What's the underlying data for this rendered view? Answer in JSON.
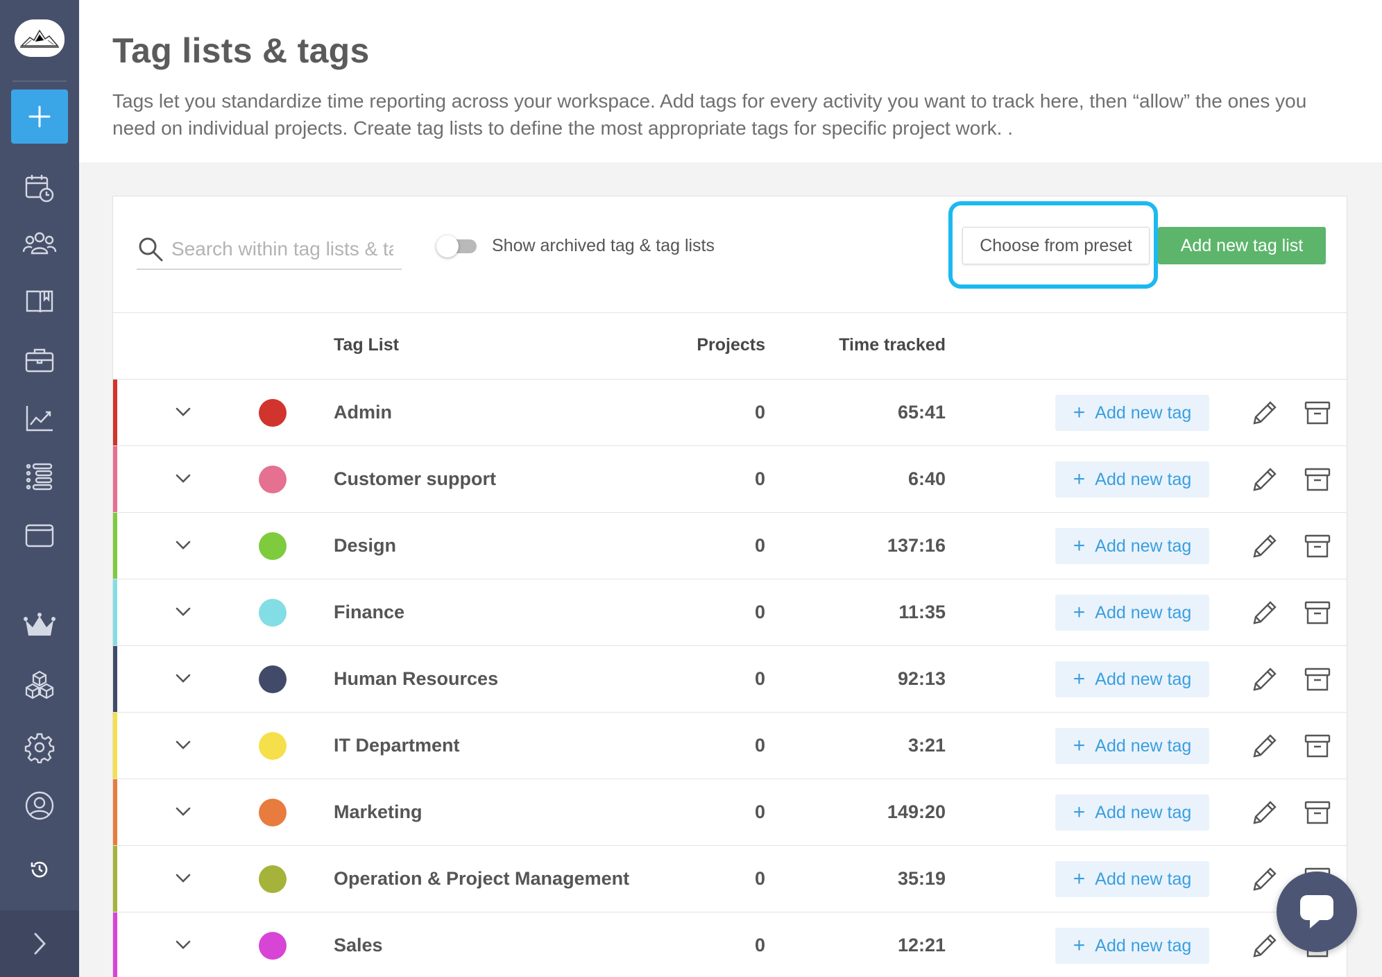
{
  "page": {
    "title": "Tag lists & tags",
    "description": "Tags let you standardize time reporting across your workspace. Add tags for every activity you want to track here, then “allow” the ones you need on individual projects. Create tag lists to define the most appropriate tags for specific project work. ."
  },
  "sidebar": {
    "icons": [
      "logo",
      "plus-icon",
      "calendar-clock-icon",
      "team-icon",
      "book-icon",
      "briefcase-icon",
      "chart-icon",
      "list-icon",
      "wallet-icon",
      "crown-icon",
      "cubes-icon",
      "gear-icon",
      "user-circle-icon",
      "history-icon",
      "chevron-right-icon"
    ]
  },
  "toolbar": {
    "search_placeholder": "Search within tag lists & tags",
    "toggle_label": "Show archived tag & tag lists",
    "toggle_on": false,
    "preset_label": "Choose from preset",
    "add_list_label": "Add new tag list"
  },
  "table": {
    "headers": {
      "name": "Tag List",
      "projects": "Projects",
      "time": "Time tracked"
    },
    "add_tag_label": "Add new tag",
    "rows": [
      {
        "name": "Admin",
        "projects": "0",
        "time": "65:41",
        "color": "#d0342c"
      },
      {
        "name": "Customer support",
        "projects": "0",
        "time": "6:40",
        "color": "#e5708f"
      },
      {
        "name": "Design",
        "projects": "0",
        "time": "137:16",
        "color": "#7ecb3d"
      },
      {
        "name": "Finance",
        "projects": "0",
        "time": "11:35",
        "color": "#83dde5"
      },
      {
        "name": "Human Resources",
        "projects": "0",
        "time": "92:13",
        "color": "#414a68"
      },
      {
        "name": "IT Department",
        "projects": "0",
        "time": "3:21",
        "color": "#f5e04b"
      },
      {
        "name": "Marketing",
        "projects": "0",
        "time": "149:20",
        "color": "#e77c3e"
      },
      {
        "name": "Operation & Project Management",
        "projects": "0",
        "time": "35:19",
        "color": "#a5b33a"
      },
      {
        "name": "Sales",
        "projects": "0",
        "time": "12:21",
        "color": "#d844d6"
      }
    ]
  },
  "colors": {
    "sidebar": "#47506b",
    "accent": "#3aa6e8",
    "green": "#5cb56b",
    "highlight": "#1cb9f0"
  }
}
